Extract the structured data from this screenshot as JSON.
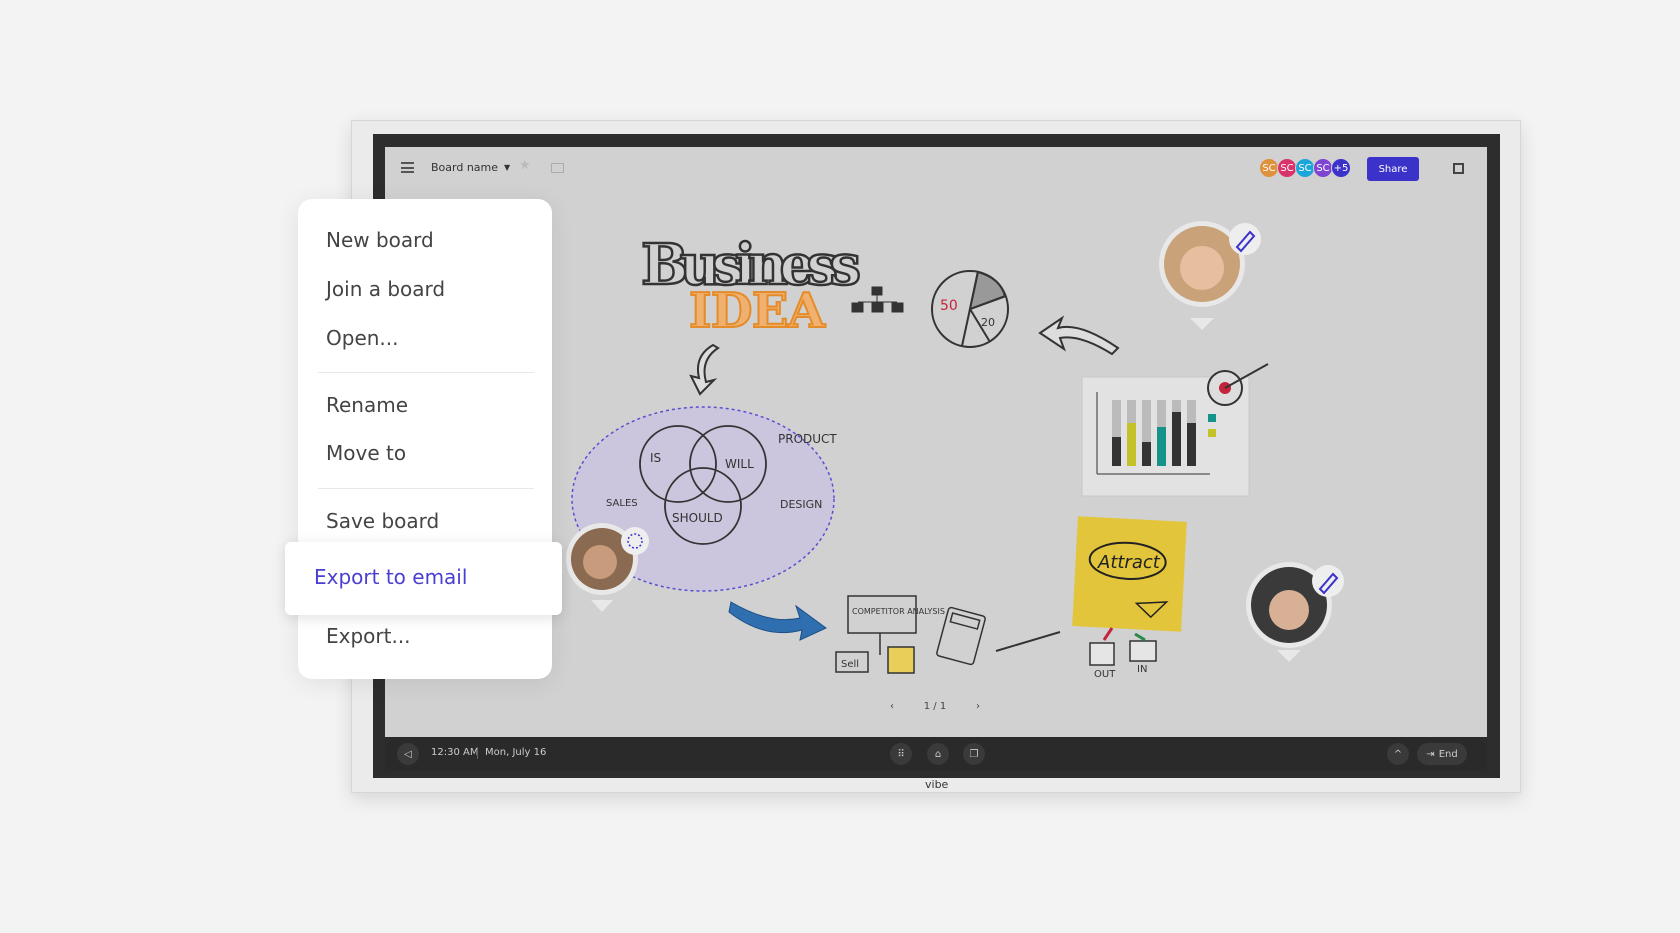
{
  "toolbar": {
    "board_name": "Board name",
    "share_label": "Share",
    "collaborators": [
      {
        "initials": "SC",
        "color": "#e0913b"
      },
      {
        "initials": "SC",
        "color": "#d9336b"
      },
      {
        "initials": "SC",
        "color": "#1aa6d9"
      },
      {
        "initials": "SC",
        "color": "#7e45d4"
      },
      {
        "initials": "+5",
        "color": "#3b32c9"
      }
    ]
  },
  "menu": {
    "items": [
      "New board",
      "Join a board",
      "Open...",
      "Rename",
      "Move to",
      "Save board",
      "Export to email",
      "Export..."
    ],
    "highlighted": "Export to email",
    "accent": "#4a3fd1"
  },
  "canvas": {
    "title_line1": "Business",
    "title_line2": "IDEA",
    "pie_labels": [
      "50",
      "20"
    ],
    "venn_labels": [
      "IS",
      "WILL",
      "SHOULD",
      "PRODUCT",
      "SALES",
      "DESIGN"
    ],
    "competitor": "COMPETITOR ANALYSIS",
    "sell": "Sell",
    "sticky": "Attract",
    "out": "OUT",
    "in": "IN"
  },
  "pagination": {
    "label": "1 / 1"
  },
  "taskbar": {
    "time": "12:30 AM",
    "date": "Mon, July 16",
    "end_label": "End"
  },
  "monitor": {
    "brand": "vibe"
  }
}
